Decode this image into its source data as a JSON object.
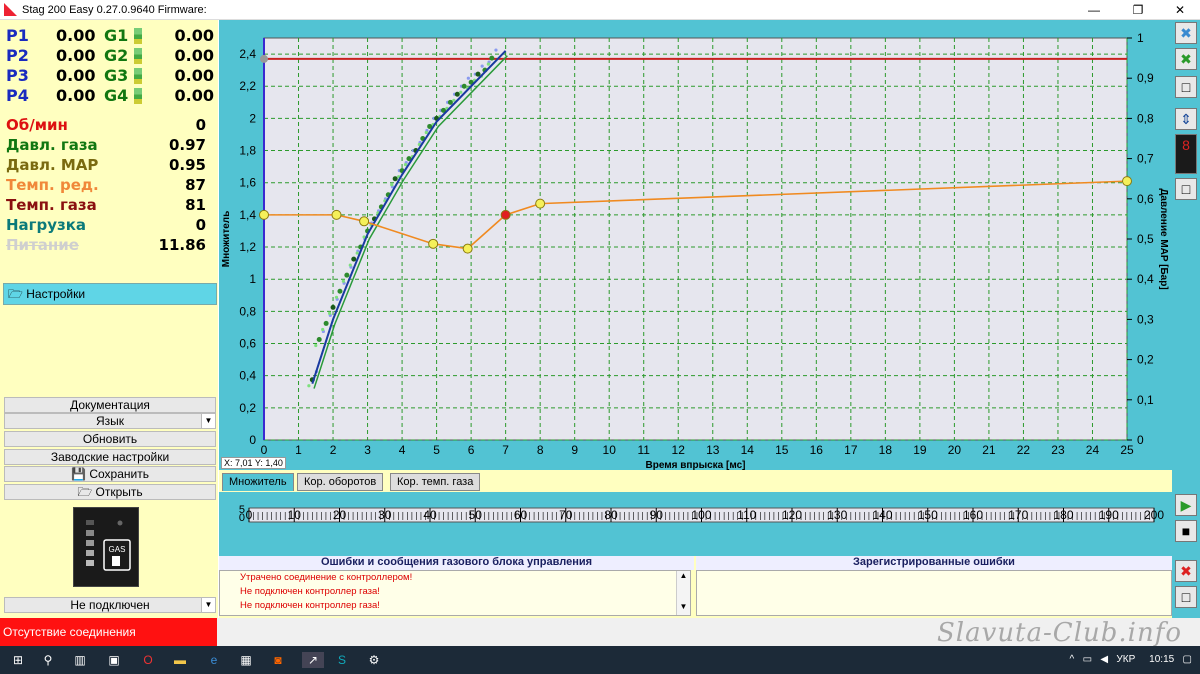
{
  "window": {
    "title": "Stag 200 Easy 0.27.0.9640 Firmware:",
    "min": "—",
    "max": "❐",
    "close": "✕"
  },
  "params": [
    {
      "p": "P1",
      "pv": "0.00",
      "g": "G1",
      "gv": "0.00"
    },
    {
      "p": "P2",
      "pv": "0.00",
      "g": "G2",
      "gv": "0.00"
    },
    {
      "p": "P3",
      "pv": "0.00",
      "g": "G3",
      "gv": "0.00"
    },
    {
      "p": "P4",
      "pv": "0.00",
      "g": "G4",
      "gv": "0.00"
    }
  ],
  "sensors": [
    {
      "label": "Об/мин",
      "value": "0",
      "color": "#d11"
    },
    {
      "label": "Давл. газа",
      "value": "0.97",
      "color": "#117711"
    },
    {
      "label": "Давл. MAP",
      "value": "0.95",
      "color": "#7a6a10"
    },
    {
      "label": "Темп. ред.",
      "value": "87",
      "color": "#f0883a"
    },
    {
      "label": "Темп. газа",
      "value": "81",
      "color": "#8a1010"
    },
    {
      "label": "Нагрузка",
      "value": "0",
      "color": "#0b7a7a"
    },
    {
      "label": "Питание",
      "value": "11.86",
      "color": "#cfcfcf"
    }
  ],
  "settings_label": "Настройки",
  "buttons": {
    "documentation": "Документация",
    "language": "Язык",
    "update": "Обновить",
    "factory": "Заводские настройки",
    "save": "Сохранить",
    "open": "Открыть"
  },
  "connection_select": "Не подключен",
  "gas_label": "GAS",
  "chart": {
    "cursor_x": "X: 7,01",
    "cursor_y": "Y: 1,40"
  },
  "chart_data": {
    "type": "line",
    "xlabel": "Время впрыска [мс]",
    "ylabel": "Множитель",
    "y2label": "Давление MAP [Бар]",
    "xlim": [
      0,
      25
    ],
    "ylim": [
      0,
      2.5
    ],
    "y2lim": [
      0,
      1.0
    ],
    "xticks": [
      "0",
      "1",
      "2",
      "3",
      "4",
      "5",
      "6",
      "7",
      "8",
      "9",
      "10",
      "11",
      "12",
      "13",
      "14",
      "15",
      "16",
      "17",
      "18",
      "19",
      "20",
      "21",
      "22",
      "23",
      "24",
      "25"
    ],
    "yticks": [
      "0",
      "0,2",
      "0,4",
      "0,6",
      "0,8",
      "1",
      "1,2",
      "1,4",
      "1,6",
      "1,8",
      "2",
      "2,2",
      "2,4"
    ],
    "y2ticks": [
      "0",
      "0,1",
      "0,2",
      "0,3",
      "0,4",
      "0,5",
      "0,6",
      "0,7",
      "0,8",
      "0,9",
      "1"
    ],
    "multiplier_curve": {
      "x": [
        0,
        2.1,
        2.9,
        4.9,
        5.9,
        7.0,
        8.0,
        25.0
      ],
      "y": [
        1.4,
        1.4,
        1.36,
        1.22,
        1.19,
        1.4,
        1.47,
        1.61
      ]
    },
    "red_point": {
      "x": 7.0,
      "y": 1.4
    },
    "max_line_y": 2.37,
    "vertical_marker_x": 0.0,
    "map_points": {
      "x": [
        1.4,
        1.6,
        1.8,
        2.0,
        2.2,
        2.4,
        2.6,
        2.8,
        3.0,
        3.2,
        3.4,
        3.6,
        3.8,
        4.0,
        4.2,
        4.4,
        4.6,
        4.8,
        5.0,
        5.2,
        5.4,
        5.6,
        5.8,
        6.0,
        6.2,
        6.4,
        6.6
      ],
      "y": [
        0.15,
        0.25,
        0.29,
        0.33,
        0.37,
        0.41,
        0.45,
        0.48,
        0.52,
        0.55,
        0.58,
        0.61,
        0.65,
        0.67,
        0.7,
        0.72,
        0.75,
        0.78,
        0.8,
        0.82,
        0.84,
        0.86,
        0.88,
        0.89,
        0.91,
        0.92,
        0.95
      ]
    },
    "fit_line": {
      "x": [
        1.4,
        2.0,
        3.0,
        4.0,
        5.0,
        6.0,
        7.0
      ],
      "y": [
        0.35,
        0.75,
        1.28,
        1.65,
        1.98,
        2.2,
        2.42
      ]
    }
  },
  "tabs": [
    "Множитель",
    "Кор. оборотов",
    "Кор. темп. газа"
  ],
  "rpm_strip": {
    "ticks": [
      "0",
      "10",
      "20",
      "30",
      "40",
      "50",
      "60",
      "70",
      "80",
      "90",
      "100",
      "110",
      "120",
      "130",
      "140",
      "150",
      "160",
      "170",
      "180",
      "190",
      "200"
    ],
    "left_labels": [
      "5",
      "0"
    ]
  },
  "messages": {
    "header_left": "Ошибки и сообщения газового блока управления",
    "header_right": "Зарегистрированные ошибки",
    "items": [
      "Утрачено соединение с контроллером!",
      "Не подключен контроллер газа!",
      "Не подключен контроллер газа!"
    ]
  },
  "status": {
    "text": "Отсутствие соединения",
    "watermark": "Slavuta-Club.info"
  },
  "taskbar": {
    "lang": "УКР",
    "time": "10:15"
  }
}
